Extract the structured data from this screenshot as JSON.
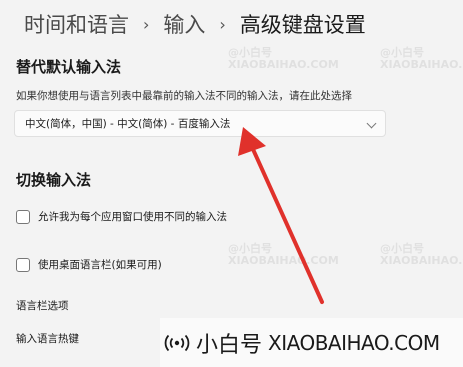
{
  "breadcrumb": {
    "items": [
      "时间和语言",
      "输入",
      "高级键盘设置"
    ]
  },
  "default_input": {
    "title": "替代默认输入法",
    "description": "如果你想使用与语言列表中最靠前的输入法不同的输入法，请在此处选择",
    "selected_value": "中文(简体，中国) - 中文(简体) - 百度输入法"
  },
  "switching": {
    "title": "切换输入法",
    "option_per_app": "允许我为每个应用窗口使用不同的输入法",
    "option_language_bar": "使用桌面语言栏(如果可用)",
    "per_app_checked": false,
    "language_bar_checked": false
  },
  "links": {
    "language_bar_options": "语言栏选项",
    "input_hotkeys": "输入语言热键"
  },
  "watermark": {
    "brand": "小白号",
    "url": "XIAOBAIHAO.COM",
    "tile_at": "@小白号",
    "tile_url": "XIAOBAIHAO.COM"
  },
  "colors": {
    "background": "#f3f3f3",
    "annotation_arrow": "#e0312b"
  }
}
